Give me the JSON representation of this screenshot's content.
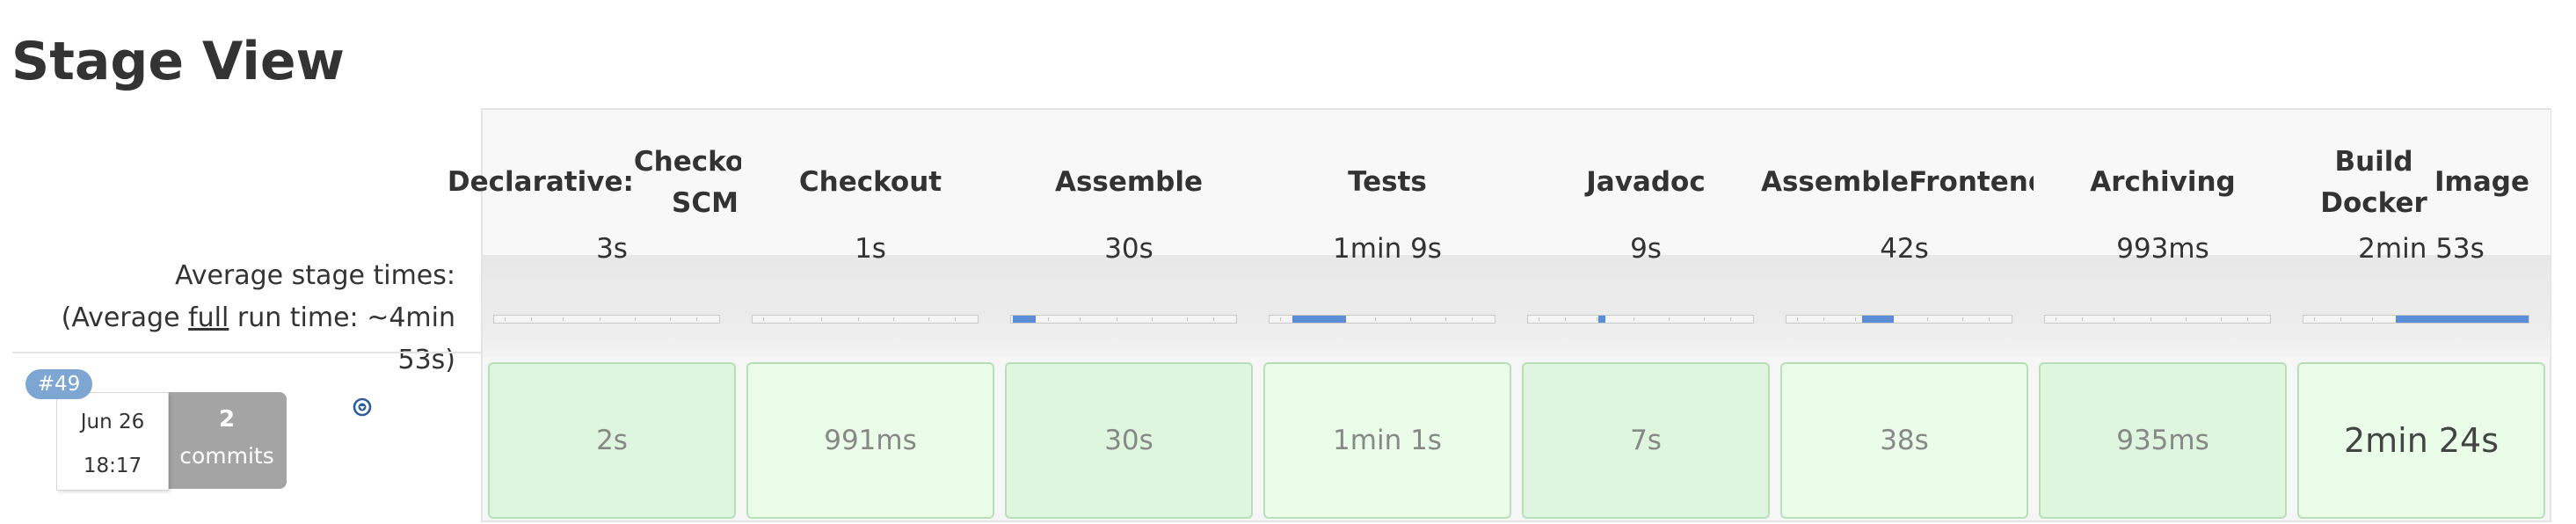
{
  "title": "Stage View",
  "average": {
    "label": "Average stage times:",
    "full_prefix": "(Average ",
    "full_word": "full",
    "full_suffix": " run time: ~4min 53s)"
  },
  "run": {
    "badge": "#49",
    "date": "Jun 26",
    "time": "18:17",
    "commit_count": "2",
    "commit_label": "commits",
    "console_icon": "download-circle-icon"
  },
  "colors": {
    "cell_green_light": "#e9fde9",
    "cell_green": "#ddf6dd",
    "cell_border": "#b8e0b8",
    "bar_fill": "#5b8ed6",
    "badge": "#7ea6d3",
    "commits_bg": "#a4a4a4"
  },
  "stages": [
    {
      "name_line1": "Declarative:",
      "name_line2": "Checkout SCM",
      "avg": "3s",
      "run_time": "2s",
      "avg_progress": 0.0
    },
    {
      "name_line1": "Checkout",
      "name_line2": "",
      "avg": "1s",
      "run_time": "991ms",
      "avg_progress": 0.0
    },
    {
      "name_line1": "Assemble",
      "name_line2": "",
      "avg": "30s",
      "run_time": "30s",
      "avg_progress": 0.1
    },
    {
      "name_line1": "Tests",
      "name_line2": "",
      "avg": "1min 9s",
      "run_time": "1min 1s",
      "avg_progress": 0.24
    },
    {
      "name_line1": "Javadoc",
      "name_line2": "",
      "avg": "9s",
      "run_time": "7s",
      "avg_progress": 0.03
    },
    {
      "name_line1": "Assemble",
      "name_line2": "Frontend",
      "avg": "42s",
      "run_time": "38s",
      "avg_progress": 0.14
    },
    {
      "name_line1": "Archiving",
      "name_line2": "",
      "avg": "993ms",
      "run_time": "935ms",
      "avg_progress": 0.0
    },
    {
      "name_line1": "Build Docker",
      "name_line2": "Image",
      "avg": "2min 53s",
      "run_time": "2min 24s",
      "avg_progress": 0.59
    }
  ]
}
